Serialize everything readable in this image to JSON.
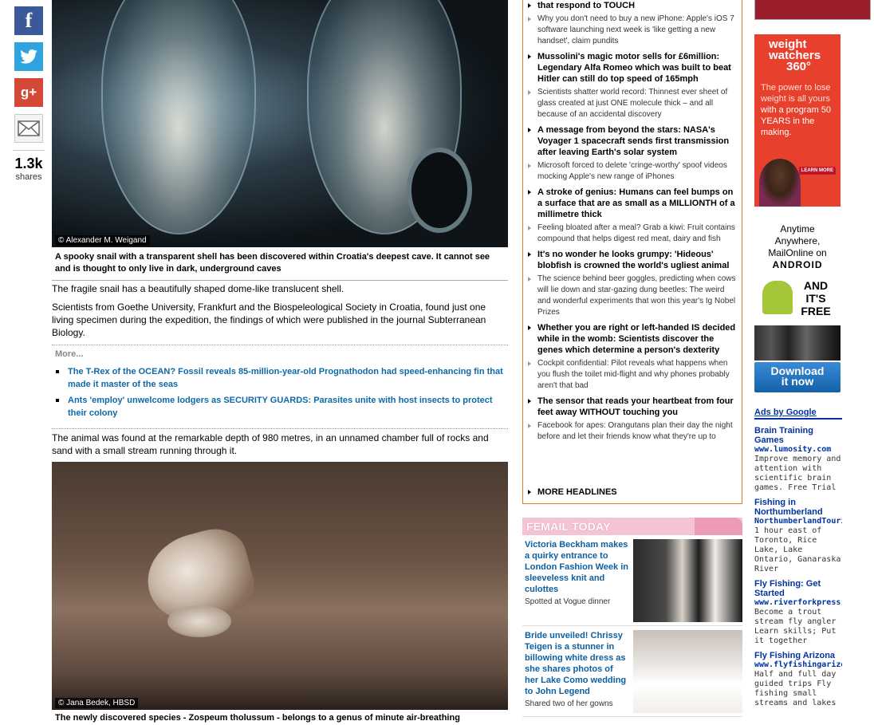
{
  "share": {
    "count": "1.3k",
    "label": "shares"
  },
  "article": {
    "image1_credit": "© Alexander M. Weigand",
    "image1_caption": "A spooky snail with a transparent shell has been discovered within Croatia's deepest cave. It cannot see and is thought to only live in dark, underground caves",
    "para1": "The fragile snail has a beautifully shaped dome-like translucent shell.",
    "para2": "Scientists from Goethe University, Frankfurt and the Biospeleological Society in Croatia, found just one living specimen during the expedition, the findings of which were published in the journal Subterranean Biology.",
    "more_title": "More...",
    "more_links": [
      "The T-Rex of the OCEAN? Fossil reveals 85-million-year-old Prognathodon had speed-enhancing fin that made it master of the seas",
      "Ants 'employ' unwelcome lodgers as SECURITY GUARDS: Parasites unite with host insects to protect their colony"
    ],
    "para3": "The animal was found at the remarkable depth of 980 metres, in an unnamed chamber full of rocks and sand with a small stream running through it.",
    "image2_credit": "© Jana Bedek, HBSD",
    "image2_caption": "The newly discovered species - Zospeum tholussum - belongs to a genus of minute air-breathing"
  },
  "headlines": [
    {
      "text": "that respond to TOUCH",
      "bold": true
    },
    {
      "text": "Why you don't need to buy a new iPhone: Apple's iOS 7 software launching next week is 'like getting a new handset', claim pundits",
      "bold": false
    },
    {
      "text": "Mussolini's magic motor sells for £6million: Legendary Alfa Romeo which was built to beat Hitler can still do top speed of 165mph",
      "bold": true
    },
    {
      "text": "Scientists shatter world record: Thinnest ever sheet of glass created at just ONE molecule thick – and all because of an accidental discovery",
      "bold": false
    },
    {
      "text": "A message from beyond the stars: NASA's Voyager 1 spacecraft sends first transmission after leaving Earth's solar system",
      "bold": true
    },
    {
      "text": "Microsoft forced to delete 'cringe-worthy' spoof videos mocking Apple's new range of iPhones",
      "bold": false
    },
    {
      "text": "A stroke of genius: Humans can feel bumps on a surface that are as small as a MILLIONTH of a millimetre thick",
      "bold": true
    },
    {
      "text": "Feeling bloated after a meal? Grab a kiwi: Fruit contains compound that helps digest red meat, dairy and fish",
      "bold": false
    },
    {
      "text": "It's no wonder he looks grumpy: 'Hideous' blobfish is crowned the world's ugliest animal",
      "bold": true
    },
    {
      "text": "The science behind beer goggles, predicting when cows will lie down and star-gazing dung beetles: The weird and wonderful experiments that won this year's Ig Nobel Prizes",
      "bold": false
    },
    {
      "text": "Whether you are right or left-handed IS decided while in the womb: Scientists discover the genes which determine a person's dexterity",
      "bold": true
    },
    {
      "text": "Cockpit confidential: Pilot reveals what happens when you flush the toilet mid-flight and why phones probably aren't that bad",
      "bold": false
    },
    {
      "text": "The sensor that reads your heartbeat from four feet away WITHOUT touching you",
      "bold": true
    },
    {
      "text": "Facebook for apes: Orangutans plan their day the night before and let their friends know what they're up to",
      "bold": false
    }
  ],
  "more_headlines": "MORE HEADLINES",
  "femail": {
    "title": "FEMAIL TODAY",
    "items": [
      {
        "headline": "Victoria Beckham makes a quirky entrance to London Fashion Week in sleeveless knit and culottes",
        "sub": "Spotted at Vogue dinner"
      },
      {
        "headline": "Bride unveiled! Chrissy Teigen is a stunner in billowing white dress as she shares photos of her Lake Como wedding to John Legend",
        "sub": "Shared two of her gowns"
      }
    ]
  },
  "ads": {
    "weightwatchers": {
      "logo_line1": "weight",
      "logo_line2": "watchers",
      "logo_line3": "360°",
      "tag1": "The power to lose weight is all yours",
      "tag2": "with a program 50 YEARS in the making.",
      "button": "LEARN MORE"
    },
    "android": {
      "line1": "Anytime",
      "line2": "Anywhere,",
      "line3": "MailOnline on",
      "brand": "ANDROID",
      "free1": "AND",
      "free2": "IT'S",
      "free3": "FREE",
      "download1": "Download",
      "download2": "it now"
    },
    "google_header": "Ads by Google",
    "google_ads": [
      {
        "title": "Brain Training Games",
        "url": "www.lumosity.com",
        "desc": "Improve memory and attention with scientific brain games. Free Trial"
      },
      {
        "title": "Fishing in Northumberland",
        "url": "NorthumberlandTourism",
        "desc": "1 hour east of Toronto, Rice Lake, Lake Ontario, Ganaraska River"
      },
      {
        "title": "Fly Fishing: Get Started",
        "url": "www.riverforkpress",
        "desc": "Become a trout stream fly angler Learn skills; Put it together"
      },
      {
        "title": "Fly Fishing Arizona",
        "url": "www.flyfishingarizona",
        "desc": "Half and full day guided trips Fly fishing small streams and lakes"
      }
    ]
  }
}
